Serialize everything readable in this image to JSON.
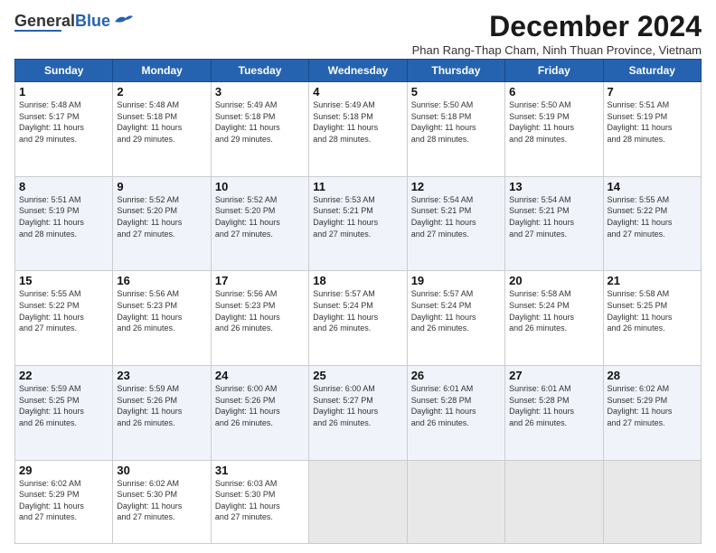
{
  "logo": {
    "general": "General",
    "blue": "Blue"
  },
  "header": {
    "month": "December 2024",
    "subtitle": "Phan Rang-Thap Cham, Ninh Thuan Province, Vietnam"
  },
  "weekdays": [
    "Sunday",
    "Monday",
    "Tuesday",
    "Wednesday",
    "Thursday",
    "Friday",
    "Saturday"
  ],
  "weeks": [
    [
      {
        "day": "1",
        "info": "Sunrise: 5:48 AM\nSunset: 5:17 PM\nDaylight: 11 hours\nand 29 minutes."
      },
      {
        "day": "2",
        "info": "Sunrise: 5:48 AM\nSunset: 5:18 PM\nDaylight: 11 hours\nand 29 minutes."
      },
      {
        "day": "3",
        "info": "Sunrise: 5:49 AM\nSunset: 5:18 PM\nDaylight: 11 hours\nand 29 minutes."
      },
      {
        "day": "4",
        "info": "Sunrise: 5:49 AM\nSunset: 5:18 PM\nDaylight: 11 hours\nand 28 minutes."
      },
      {
        "day": "5",
        "info": "Sunrise: 5:50 AM\nSunset: 5:18 PM\nDaylight: 11 hours\nand 28 minutes."
      },
      {
        "day": "6",
        "info": "Sunrise: 5:50 AM\nSunset: 5:19 PM\nDaylight: 11 hours\nand 28 minutes."
      },
      {
        "day": "7",
        "info": "Sunrise: 5:51 AM\nSunset: 5:19 PM\nDaylight: 11 hours\nand 28 minutes."
      }
    ],
    [
      {
        "day": "8",
        "info": "Sunrise: 5:51 AM\nSunset: 5:19 PM\nDaylight: 11 hours\nand 28 minutes."
      },
      {
        "day": "9",
        "info": "Sunrise: 5:52 AM\nSunset: 5:20 PM\nDaylight: 11 hours\nand 27 minutes."
      },
      {
        "day": "10",
        "info": "Sunrise: 5:52 AM\nSunset: 5:20 PM\nDaylight: 11 hours\nand 27 minutes."
      },
      {
        "day": "11",
        "info": "Sunrise: 5:53 AM\nSunset: 5:21 PM\nDaylight: 11 hours\nand 27 minutes."
      },
      {
        "day": "12",
        "info": "Sunrise: 5:54 AM\nSunset: 5:21 PM\nDaylight: 11 hours\nand 27 minutes."
      },
      {
        "day": "13",
        "info": "Sunrise: 5:54 AM\nSunset: 5:21 PM\nDaylight: 11 hours\nand 27 minutes."
      },
      {
        "day": "14",
        "info": "Sunrise: 5:55 AM\nSunset: 5:22 PM\nDaylight: 11 hours\nand 27 minutes."
      }
    ],
    [
      {
        "day": "15",
        "info": "Sunrise: 5:55 AM\nSunset: 5:22 PM\nDaylight: 11 hours\nand 27 minutes."
      },
      {
        "day": "16",
        "info": "Sunrise: 5:56 AM\nSunset: 5:23 PM\nDaylight: 11 hours\nand 26 minutes."
      },
      {
        "day": "17",
        "info": "Sunrise: 5:56 AM\nSunset: 5:23 PM\nDaylight: 11 hours\nand 26 minutes."
      },
      {
        "day": "18",
        "info": "Sunrise: 5:57 AM\nSunset: 5:24 PM\nDaylight: 11 hours\nand 26 minutes."
      },
      {
        "day": "19",
        "info": "Sunrise: 5:57 AM\nSunset: 5:24 PM\nDaylight: 11 hours\nand 26 minutes."
      },
      {
        "day": "20",
        "info": "Sunrise: 5:58 AM\nSunset: 5:24 PM\nDaylight: 11 hours\nand 26 minutes."
      },
      {
        "day": "21",
        "info": "Sunrise: 5:58 AM\nSunset: 5:25 PM\nDaylight: 11 hours\nand 26 minutes."
      }
    ],
    [
      {
        "day": "22",
        "info": "Sunrise: 5:59 AM\nSunset: 5:25 PM\nDaylight: 11 hours\nand 26 minutes."
      },
      {
        "day": "23",
        "info": "Sunrise: 5:59 AM\nSunset: 5:26 PM\nDaylight: 11 hours\nand 26 minutes."
      },
      {
        "day": "24",
        "info": "Sunrise: 6:00 AM\nSunset: 5:26 PM\nDaylight: 11 hours\nand 26 minutes."
      },
      {
        "day": "25",
        "info": "Sunrise: 6:00 AM\nSunset: 5:27 PM\nDaylight: 11 hours\nand 26 minutes."
      },
      {
        "day": "26",
        "info": "Sunrise: 6:01 AM\nSunset: 5:28 PM\nDaylight: 11 hours\nand 26 minutes."
      },
      {
        "day": "27",
        "info": "Sunrise: 6:01 AM\nSunset: 5:28 PM\nDaylight: 11 hours\nand 26 minutes."
      },
      {
        "day": "28",
        "info": "Sunrise: 6:02 AM\nSunset: 5:29 PM\nDaylight: 11 hours\nand 27 minutes."
      }
    ],
    [
      {
        "day": "29",
        "info": "Sunrise: 6:02 AM\nSunset: 5:29 PM\nDaylight: 11 hours\nand 27 minutes."
      },
      {
        "day": "30",
        "info": "Sunrise: 6:02 AM\nSunset: 5:30 PM\nDaylight: 11 hours\nand 27 minutes."
      },
      {
        "day": "31",
        "info": "Sunrise: 6:03 AM\nSunset: 5:30 PM\nDaylight: 11 hours\nand 27 minutes."
      },
      {
        "day": "",
        "info": ""
      },
      {
        "day": "",
        "info": ""
      },
      {
        "day": "",
        "info": ""
      },
      {
        "day": "",
        "info": ""
      }
    ]
  ]
}
